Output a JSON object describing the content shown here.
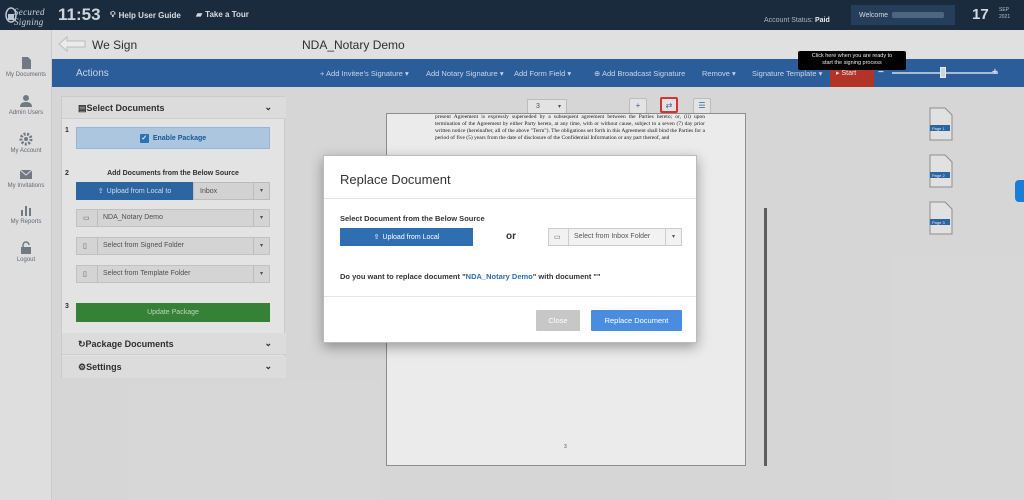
{
  "header": {
    "logo_text": "Secured Signing",
    "clock": "11:53",
    "help_label": "Help User Guide",
    "tour_label": "Take a Tour",
    "account_status_label": "Account Status:",
    "account_status_value": "Paid",
    "welcome_label": "Welcome",
    "date_day": "17",
    "date_month": "SEP",
    "date_year": "2021"
  },
  "nav": {
    "items": [
      {
        "label": "My Documents"
      },
      {
        "label": "Admin Users"
      },
      {
        "label": "My Account"
      },
      {
        "label": "My Invitations"
      },
      {
        "label": "My Reports"
      },
      {
        "label": "Logout"
      }
    ]
  },
  "title_row": {
    "app_title": "We Sign",
    "document_name": "NDA_Notary Demo"
  },
  "actions_bar": {
    "label": "Actions",
    "add_invitee": "+ Add Invitee's Signature",
    "add_notary": "Add Notary Signature",
    "add_form_field": "Add Form Field",
    "add_broadcast": "Add Broadcast Signature",
    "remove": "Remove",
    "signature_template": "Signature Template",
    "start": "Start",
    "zoom_minus": "−",
    "zoom_plus": "+",
    "zoom_level": 0.48
  },
  "tooltip": {
    "line1": "Click here when you are ready to",
    "line2": "start the signing process"
  },
  "left_panel": {
    "select_documents": "Select Documents",
    "step1": "1",
    "enable_package": "Enable Package",
    "step2": "2",
    "add_docs_title": "Add Documents from the Below Source",
    "upload_local": "Upload from Local to",
    "inbox_value": "Inbox",
    "doc_source_value": "NDA_Notary Demo",
    "signed_folder": "Select from Signed Folder",
    "template_folder": "Select from Template Folder",
    "step3": "3",
    "update_package": "Update Package",
    "package_documents": "Package Documents",
    "settings": "Settings"
  },
  "document": {
    "page_value": "3",
    "page_number": "3",
    "text": "present Agreement is expressly superseded by a subsequent agreement between the Parties hereto; or, (ii) upon termination of the Agreement by either Party hereto, at any time, with or without cause, subject to a seven (7) day prior written notice (hereinafter, all of the above \"Term\"). The obligations set forth in this Agreement shall bind the Parties for a period of five (5) years from the date of disclosure of the Confidential Information or any part thereof, and",
    "thumbnails": [
      "Page 1",
      "Page 2",
      "Page 3"
    ]
  },
  "modal": {
    "title": "Replace Document",
    "source_label": "Select Document from the Below Source",
    "upload_local": "Upload from Local",
    "or": "or",
    "inbox_folder": "Select from Inbox Folder",
    "question_prefix": "Do you want to replace document \"",
    "question_doc": "NDA_Notary Demo",
    "question_suffix": "\" with document \"\"",
    "close": "Close",
    "replace": "Replace Document"
  },
  "colors": {
    "topbar": "#1d2f43",
    "actions_bar": "#2e65a8",
    "start_button": "#c0392b",
    "update_package": "#3a8c3a",
    "primary_button": "#4a8cdf"
  }
}
